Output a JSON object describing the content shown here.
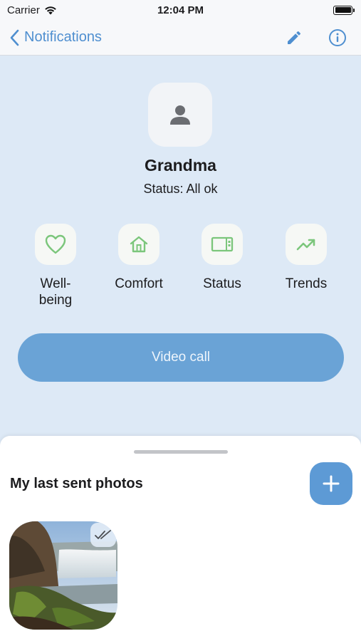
{
  "status_bar": {
    "carrier": "Carrier",
    "time": "12:04 PM"
  },
  "nav": {
    "back_label": "Notifications",
    "icons": [
      "back-chevron-icon",
      "pencil-icon",
      "info-icon"
    ]
  },
  "profile": {
    "name": "Grandma",
    "status": "Status: All ok",
    "avatar_icon": "person-icon"
  },
  "tiles": [
    {
      "label": "Well-\nbeing",
      "icon": "heart-icon"
    },
    {
      "label": "Comfort",
      "icon": "house-icon"
    },
    {
      "label": "Status",
      "icon": "device-icon"
    },
    {
      "label": "Trends",
      "icon": "trend-up-icon"
    }
  ],
  "video_call": {
    "label": "Video call"
  },
  "sheet": {
    "title": "My last sent photos",
    "add_icon": "plus-icon",
    "photos": [
      {
        "subject": "waterfall",
        "status_icon": "double-check-icon"
      }
    ]
  },
  "colors": {
    "accent": "#4f8fd0",
    "background": "#dde9f6",
    "tile_icon_green": "#7bc67b",
    "button_blue": "#6aa3d6",
    "add_button": "#5d9ad5"
  }
}
